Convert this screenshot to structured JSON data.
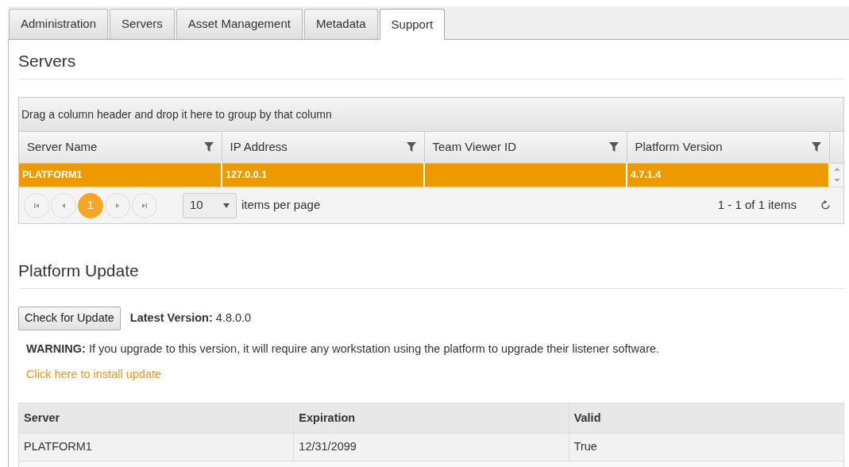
{
  "tabs": [
    {
      "label": "Administration",
      "selected": false
    },
    {
      "label": "Servers",
      "selected": false
    },
    {
      "label": "Asset Management",
      "selected": false
    },
    {
      "label": "Metadata",
      "selected": false
    },
    {
      "label": "Support",
      "selected": true
    }
  ],
  "servers": {
    "title": "Servers",
    "group_hint": "Drag a column header and drop it here to group by that column",
    "columns": [
      "Server Name",
      "IP Address",
      "Team Viewer ID",
      "Platform Version"
    ],
    "rows": [
      {
        "cells": [
          "PLATFORM1",
          "127.0.0.1",
          null,
          "4.7.1.4"
        ],
        "selected": true
      }
    ],
    "pager": {
      "current_page": "1",
      "page_size": "10",
      "page_size_label": "items per page",
      "summary": "1 - 1 of 1 items"
    }
  },
  "platform_update": {
    "title": "Platform Update",
    "button": "Check for Update",
    "latest_version": "**Latest Version:** 4.8.0.0",
    "warning": "**WARNING:** If you upgrade to this version, it will require any workstation using the platform to upgrade their listener software.",
    "install_link": "Click here to install update"
  },
  "license_table": {
    "columns": [
      "Server",
      "Expiration",
      "Valid"
    ],
    "rows": [
      [
        "PLATFORM1",
        "12/31/2099",
        "True"
      ]
    ]
  }
}
